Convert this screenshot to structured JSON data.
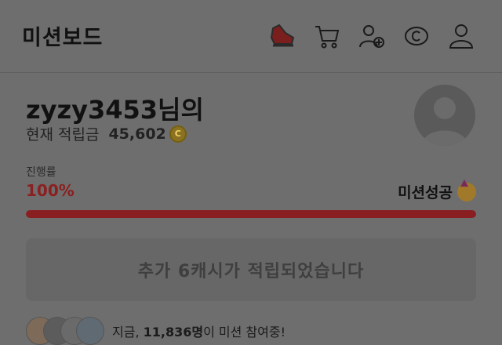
{
  "header": {
    "title": "미션보드",
    "icons": [
      "sneaker-icon",
      "cart-icon",
      "add-friend-icon",
      "coin-icon",
      "profile-icon"
    ]
  },
  "user": {
    "name": "zyzy3453님의",
    "points_label": "현재 적립금",
    "points_value": "45,602",
    "coin_symbol": "C"
  },
  "progress": {
    "label": "진행률",
    "percent_text": "100%",
    "value": 1.0,
    "status": "미션성공",
    "status_emoji": "party-face-icon"
  },
  "message": {
    "text": "추가 6캐시가 적립되었습니다"
  },
  "participants": {
    "prefix": "지금, ",
    "count": "11,836명",
    "suffix": "이 미션 참여중!"
  },
  "colors": {
    "accent": "#8a1f22",
    "coin": "#8a7222",
    "overlay": "#6e6e6e"
  }
}
